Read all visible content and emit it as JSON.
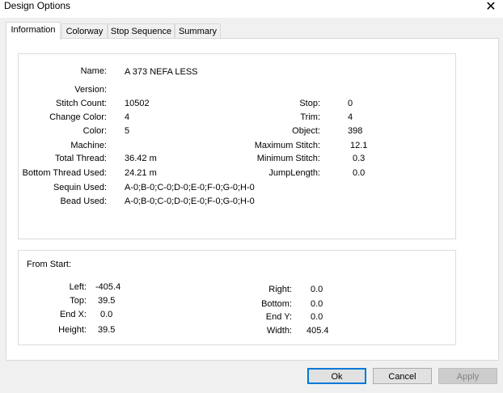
{
  "window": {
    "title": "Design Options",
    "close_glyph": "✕"
  },
  "tabs": [
    {
      "label": "Information",
      "active": true
    },
    {
      "label": "Colorway",
      "active": false
    },
    {
      "label": "Stop Sequence",
      "active": false
    },
    {
      "label": "Summary",
      "active": false
    }
  ],
  "info": {
    "name_label": "Name:",
    "name_value": "A 373 NEFA LESS",
    "version_label": "Version:",
    "version_value": "",
    "stitch_count_label": "Stitch Count:",
    "stitch_count_value": "10502",
    "change_color_label": "Change Color:",
    "change_color_value": "4",
    "color_label": "Color:",
    "color_value": "5",
    "machine_label": "Machine:",
    "machine_value": "",
    "total_thread_label": "Total Thread:",
    "total_thread_value": "36.42 m",
    "bottom_thread_label": "Bottom Thread Used:",
    "bottom_thread_value": "24.21 m",
    "sequin_label": "Sequin Used:",
    "sequin_value": "A-0;B-0;C-0;D-0;E-0;F-0;G-0;H-0",
    "bead_label": "Bead Used:",
    "bead_value": "A-0;B-0;C-0;D-0;E-0;F-0;G-0;H-0",
    "stop_label": "Stop:",
    "stop_value": "0",
    "trim_label": "Trim:",
    "trim_value": "4",
    "object_label": "Object:",
    "object_value": "398",
    "max_stitch_label": "Maximum Stitch:",
    "max_stitch_value": "12.1",
    "min_stitch_label": "Minimum Stitch:",
    "min_stitch_value": "0.3",
    "jump_length_label": "JumpLength:",
    "jump_length_value": "0.0"
  },
  "from_start": {
    "heading": "From Start:",
    "left_label": "Left:",
    "left_value": "-405.4",
    "top_label": "Top:",
    "top_value": "39.5",
    "endx_label": "End X:",
    "endx_value": "0.0",
    "height_label": "Height:",
    "height_value": "39.5",
    "right_label": "Right:",
    "right_value": "0.0",
    "bottom_label": "Bottom:",
    "bottom_value": "0.0",
    "endy_label": "End Y:",
    "endy_value": "0.0",
    "width_label": "Width:",
    "width_value": "405.4"
  },
  "buttons": {
    "ok": "Ok",
    "cancel": "Cancel",
    "apply": "Apply"
  }
}
